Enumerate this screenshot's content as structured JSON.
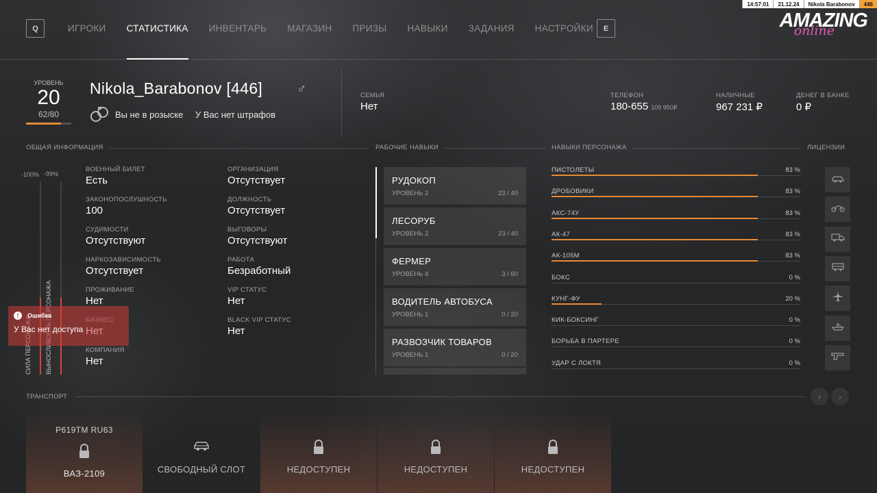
{
  "status": {
    "time": "14:57:01",
    "date": "21.12.24",
    "player": "Nikola Barabonov",
    "level": "446"
  },
  "nav": {
    "key_left": "Q",
    "key_right": "E",
    "tabs": [
      "ИГРОКИ",
      "СТАТИСТИКА",
      "ИНВЕНТАРЬ",
      "МАГАЗИН",
      "ПРИЗЫ",
      "НАВЫКИ",
      "ЗАДАНИЯ",
      "НАСТРОЙКИ"
    ],
    "active_tab": "СТАТИСТИКА"
  },
  "logo": {
    "main": "AMAZING",
    "sub": "online"
  },
  "level": {
    "label": "УРОВЕНЬ",
    "value": "20",
    "exp": "62/80",
    "progress": 0.775
  },
  "player": {
    "name": "Nikola_Barabonov [446]",
    "gender_symbol": "♂",
    "wanted": "Вы не в розыске",
    "fines": "У Вас нет штрафов"
  },
  "header_stats": {
    "family": {
      "label": "СЕМЬЯ",
      "value": "Нет"
    },
    "phone": {
      "label": "ТЕЛЕФОН",
      "value": "180-655",
      "extra": "109 950₽"
    },
    "cash": {
      "label": "НАЛИЧНЫЕ",
      "value": "967 231 ₽"
    },
    "bank": {
      "label": "ДЕНЕГ В БАНКЕ",
      "value": "0 ₽"
    }
  },
  "sections": {
    "general": "ОБЩАЯ ИНФОРМАЦИЯ",
    "work_skills": "РАБОЧИЕ НАВЫКИ",
    "char_skills": "НАВЫКИ ПЕРСОНАЖА",
    "licenses": "ЛИЦЕНЗИИ",
    "transport": "ТРАНСПОРТ"
  },
  "vertical_stats": {
    "strength": {
      "label": "СИЛА ПЕРСОНАЖА",
      "pct_text": "-100%",
      "value": 0.4
    },
    "stamina": {
      "label": "ВЫНОСЛИВОСТЬ ПЕРСОНАЖА",
      "pct_text": "-99%",
      "value": 0.4
    }
  },
  "info_left": [
    {
      "label": "ВОЕННЫЙ БИЛЕТ",
      "value": "Есть"
    },
    {
      "label": "ЗАКОНОПОСЛУШНОСТЬ",
      "value": "100"
    },
    {
      "label": "СУДИМОСТИ",
      "value": "Отсутствуют"
    },
    {
      "label": "НАРКОЗАВИСИМОСТЬ",
      "value": "Отсутствует"
    },
    {
      "label": "ПРОЖИВАНИЕ",
      "value": "Нет"
    },
    {
      "label": "БИЗНЕС",
      "value": "Нет"
    },
    {
      "label": "КОМПАНИЯ",
      "value": "Нет"
    }
  ],
  "info_right": [
    {
      "label": "ОРГАНИЗАЦИЯ",
      "value": "Отсутствует"
    },
    {
      "label": "ДОЛЖНОСТЬ",
      "value": "Отсутствует"
    },
    {
      "label": "ВЫГОВОРЫ",
      "value": "Отсутствуют"
    },
    {
      "label": "РАБОТА",
      "value": "Безработный"
    },
    {
      "label": "VIP СТАТУС",
      "value": "Нет"
    },
    {
      "label": "BLACK VIP СТАТУС",
      "value": "Нет"
    }
  ],
  "toast": {
    "title": "Ошибка",
    "text": "У Вас нет доступа"
  },
  "jobs": [
    {
      "name": "РУДОКОП",
      "level": "УРОВЕНЬ 2",
      "progress": "23 / 40"
    },
    {
      "name": "ЛЕСОРУБ",
      "level": "УРОВЕНЬ 2",
      "progress": "23 / 40"
    },
    {
      "name": "ФЕРМЕР",
      "level": "УРОВЕНЬ 4",
      "progress": "3 / 60"
    },
    {
      "name": "ВОДИТЕЛЬ АВТОБУСА",
      "level": "УРОВЕНЬ 1",
      "progress": "0 / 20"
    },
    {
      "name": "РАЗВОЗЧИК ТОВАРОВ",
      "level": "УРОВЕНЬ 1",
      "progress": "0 / 20"
    }
  ],
  "skills": [
    {
      "name": "ПИСТОЛЕТЫ",
      "pct": "83 %",
      "value": 83
    },
    {
      "name": "ДРОБОВИКИ",
      "pct": "83 %",
      "value": 83
    },
    {
      "name": "АКС-74У",
      "pct": "83 %",
      "value": 83
    },
    {
      "name": "АК-47",
      "pct": "83 %",
      "value": 83
    },
    {
      "name": "АК-105М",
      "pct": "83 %",
      "value": 83
    },
    {
      "name": "БОКС",
      "pct": "0 %",
      "value": 0
    },
    {
      "name": "КУНГ-ФУ",
      "pct": "20 %",
      "value": 20
    },
    {
      "name": "КИК-БОКСИНГ",
      "pct": "0 %",
      "value": 0
    },
    {
      "name": "БОРЬБА В ПАРТЕРЕ",
      "pct": "0 %",
      "value": 0
    },
    {
      "name": "УДАР С ЛОКТЯ",
      "pct": "0 %",
      "value": 0
    }
  ],
  "licenses": [
    "car-icon",
    "motorcycle-icon",
    "truck-icon",
    "bus-icon",
    "plane-icon",
    "boat-icon",
    "gun-icon"
  ],
  "transport": {
    "slots": [
      {
        "plate": "Р619ТМ RU63",
        "label": "ВАЗ-2109",
        "icon": "lock-icon",
        "state": "owned"
      },
      {
        "plate": "",
        "label": "СВОБОДНЫЙ СЛОТ",
        "icon": "car-icon",
        "state": "free"
      },
      {
        "plate": "",
        "label": "НЕДОСТУПЕН",
        "icon": "lock-icon",
        "state": "locked"
      },
      {
        "plate": "",
        "label": "НЕДОСТУПЕН",
        "icon": "lock-icon",
        "state": "locked"
      },
      {
        "plate": "",
        "label": "НЕДОСТУПЕН",
        "icon": "lock-icon",
        "state": "locked"
      }
    ]
  },
  "colors": {
    "accent": "#e98a34",
    "danger": "#d9443b",
    "brand_pink": "#e259b4"
  }
}
